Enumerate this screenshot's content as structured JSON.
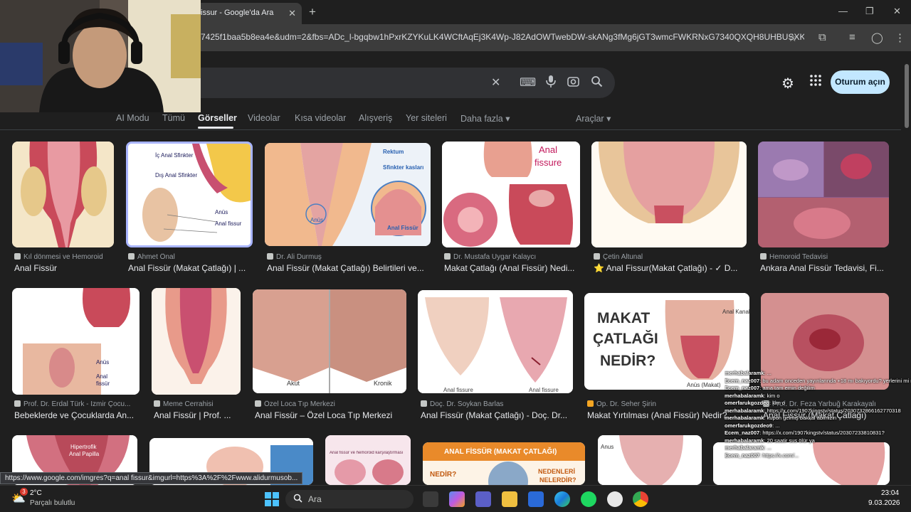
{
  "browser": {
    "tab_title": "issur - Google'da Ara",
    "tab_close": "✕",
    "new_tab": "+",
    "url": "7425f1baa5b8ea4e&udm=2&fbs=ADc_l-bgqbw1hPxrKZYKuLK4WCftAqEj3K4Wp-J82AdOWTwebDW-skANg3fMg6jGT3wmcFWKRNxG7340QXQH8UHBUSXKB...",
    "minimize": "—",
    "maximize": "❐",
    "close": "✕"
  },
  "google": {
    "signin_label": "Oturum açın",
    "nav": [
      "AI Modu",
      "Tümü",
      "Görseller",
      "Videolar",
      "Kısa videolar",
      "Alışveriş",
      "Yer siteleri",
      "Daha fazla ▾"
    ],
    "tools": "Araçlar ▾"
  },
  "results_row1": [
    {
      "source": "Kıl dönmesi ve Hemoroid",
      "title": "Anal Fissür"
    },
    {
      "source": "Ahmet Önal",
      "title": "Anal Fissür (Makat Çatlağı) | ..."
    },
    {
      "source": "Dr. Ali Durmuş",
      "title": "Anal Fissür (Makat Çatlağı) Belirtileri ve..."
    },
    {
      "source": "Dr. Mustafa Uygar Kalaycı",
      "title": "Makat Çatlağı (Anal Fissür) Nedi..."
    },
    {
      "source": "Çetin Altunal",
      "title": "⭐ Anal Fissur(Makat Çatlağı) - ✓ D..."
    },
    {
      "source": "Hemoroid Tedavisi",
      "title": "Ankara Anal Fissür Tedavisi, Fi..."
    }
  ],
  "results_row2": [
    {
      "source": "Prof. Dr. Erdal Türk - İzmir Çocu...",
      "title": "Bebeklerde ve Çocuklarda An..."
    },
    {
      "source": "Meme Cerrahisi",
      "title": "Anal Fissür | Prof. ..."
    },
    {
      "source": "Özel Loca Tıp Merkezi",
      "title": "Anal Fissür – Özel Loca Tıp Merkezi"
    },
    {
      "source": "Doç. Dr. Soykan Barlas",
      "title": "Anal Fissür (Makat Çatlağı) - Doç. Dr..."
    },
    {
      "source": "Op. Dr. Seher Şirin",
      "title": "Makat Yırtılması (Anal Fissür) Nedir? ..."
    },
    {
      "source": "Prof. Dr. Feza Yarbuğ Karakayalı",
      "title": "Anal Fissür (Makat Çatlağı)"
    }
  ],
  "image_labels": {
    "r1c2": [
      "İç Anal Sfinkter",
      "Dış Anal Sfinkter",
      "Anüs",
      "Anal fissur"
    ],
    "r1c3": [
      "Rektum",
      "Sfinkter kasları",
      "Anüs",
      "Anal Fissür"
    ],
    "r1c4": [
      "Anal",
      "fissure"
    ],
    "r2c1": [
      "Anüs",
      "Anal",
      "fissür"
    ],
    "r2c3": [
      "Akut",
      "Kronik"
    ],
    "r2c4": [
      "Anal fissure",
      "Anal fissure"
    ],
    "r2c5": [
      "MAKAT",
      "ÇATLAĞI",
      "NEDİR?",
      "Anal Kanal",
      "Anüs (Makat)"
    ],
    "r3c1": [
      "Hipertrofik",
      "Anal Papilla"
    ],
    "r3c4": [
      "ANAL FİSSÜR (MAKAT ÇATLAĞI)",
      "NEDİR?",
      "NEDENLERİ",
      "NELERDİR?"
    ],
    "r3c5": [
      "Anus"
    ],
    "r3c3": [
      "Anal fissür ve hemoroid karşılaştırması"
    ]
  },
  "status_url": "https://www.google.com/imgres?q=anal fissur&imgurl=https%3A%2F%2Fwww.alidurmusob...",
  "chat": [
    {
      "user": "merhabalaramk",
      "msg": ": ..."
    },
    {
      "user": "Ecem_naz007",
      "msg": ": bu adam onceden yayınlarında +18 mı bakıyordu? yerlerini mi ne gosteriyomus galiba"
    },
    {
      "user": "Ecem_naz007",
      "msg": ": ama tam emin değilim"
    },
    {
      "user": "merhabalaramk",
      "msg": ": kim o"
    },
    {
      "user": "omerfarukgozdeo",
      "msg": ": kim o"
    },
    {
      "user": "merhabalaramk",
      "msg": ": https://x.com/1907kingstv/status/2030732866162770318"
    },
    {
      "user": "merhabalaramk",
      "msg": ": kupon gelmiş bakkal abimizin"
    },
    {
      "user": "omerfarukgozdeo9",
      "msg": ": ..."
    },
    {
      "user": "Ecem_naz007",
      "msg": ": https://x.com/1907kingstv/status/20307233810831?"
    },
    {
      "user": "merhabalaramk",
      "msg": ": 20 saatir sus ölür ya"
    },
    {
      "user": "merhabalaramk",
      "msg": ": ..."
    },
    {
      "user": "Ecem_naz007",
      "msg": ": https://x.com/..."
    }
  ],
  "taskbar": {
    "weather_temp": "2°C",
    "weather_desc": "Parçalı bulutlu",
    "weather_badge": "3",
    "search_label": "Ara",
    "time": "23:04",
    "date": "9.03.2026"
  },
  "colors": {
    "bg": "#1f1f1f",
    "signin": "#c2e7ff",
    "accent": "#e8eaed"
  }
}
